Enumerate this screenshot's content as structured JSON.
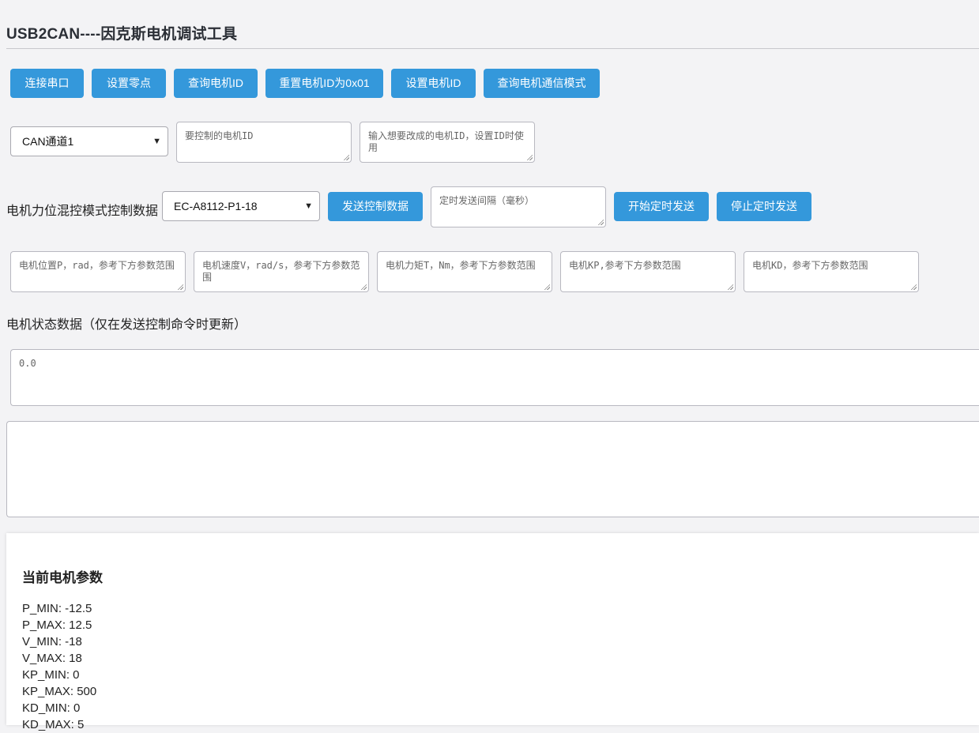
{
  "app": {
    "title": "USB2CAN----因克斯电机调试工具"
  },
  "toolbar": {
    "connect": "连接串口",
    "set_zero": "设置零点",
    "query_id": "查询电机ID",
    "reset_id": "重置电机ID为0x01",
    "set_id": "设置电机ID",
    "query_mode": "查询电机通信模式"
  },
  "channel": {
    "selected": "CAN通道1",
    "motor_id_placeholder": "要控制的电机ID",
    "new_id_placeholder": "输入想要改成的电机ID，设置ID时使用"
  },
  "control": {
    "label": "电机力位混控模式控制数据",
    "model_selected": "EC-A8112-P1-18",
    "send_button": "发送控制数据",
    "interval_placeholder": "定时发送间隔（毫秒）",
    "start_timer": "开始定时发送",
    "stop_timer": "停止定时发送"
  },
  "params_inputs": {
    "position": "电机位置P，rad，参考下方参数范围",
    "velocity": "电机速度V，rad/s，参考下方参数范围",
    "torque": "电机力矩T，Nm，参考下方参数范围",
    "kp": "电机KP,参考下方参数范围",
    "kd": "电机KD，参考下方参数范围"
  },
  "status": {
    "label": "电机状态数据（仅在发送控制命令时更新）",
    "value": "0.0",
    "log": ""
  },
  "current_params": {
    "title": "当前电机参数",
    "items": [
      "P_MIN: -12.5",
      "P_MAX: 12.5",
      "V_MIN: -18",
      "V_MAX: 18",
      "KP_MIN: 0",
      "KP_MAX: 500",
      "KD_MIN: 0",
      "KD_MAX: 5"
    ]
  },
  "colors": {
    "accent": "#3498db",
    "background": "#f3f3f5"
  }
}
